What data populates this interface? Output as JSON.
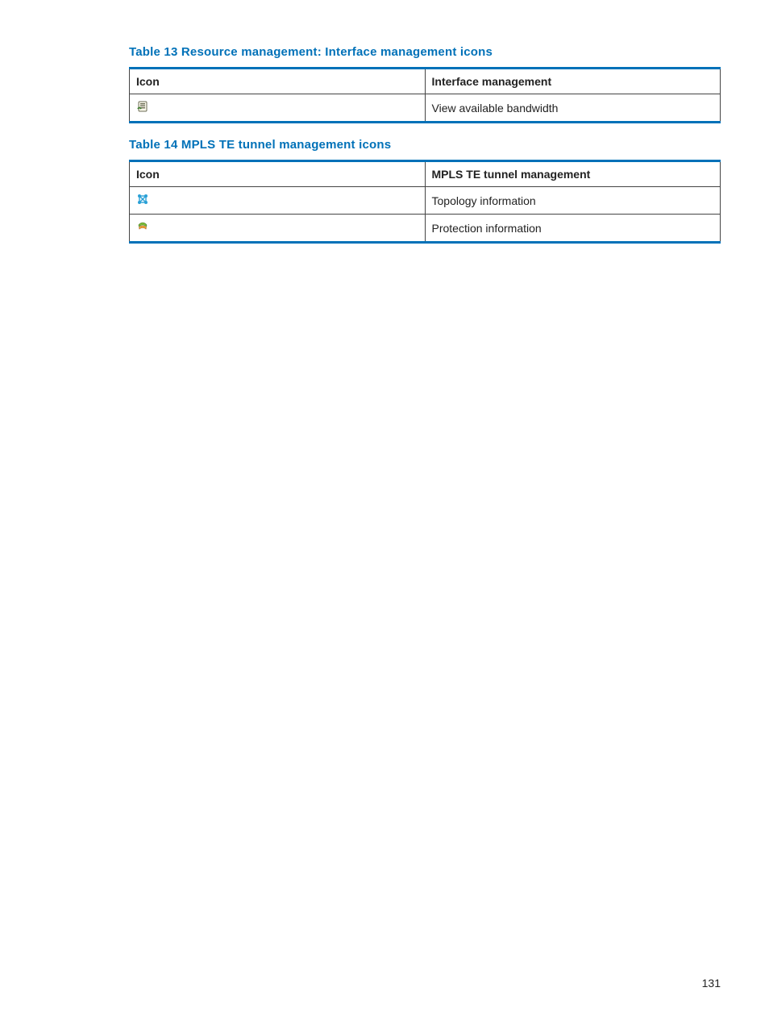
{
  "table13": {
    "caption": "Table 13 Resource management: Interface management icons",
    "header_icon": "Icon",
    "header_desc": "Interface management",
    "rows": [
      {
        "icon": "bandwidth-icon",
        "desc": "View available bandwidth"
      }
    ]
  },
  "table14": {
    "caption": "Table 14 MPLS TE tunnel management icons",
    "header_icon": "Icon",
    "header_desc": "MPLS TE tunnel management",
    "rows": [
      {
        "icon": "topology-icon",
        "desc": "Topology information"
      },
      {
        "icon": "protection-icon",
        "desc": "Protection information"
      }
    ]
  },
  "page_number": "131"
}
